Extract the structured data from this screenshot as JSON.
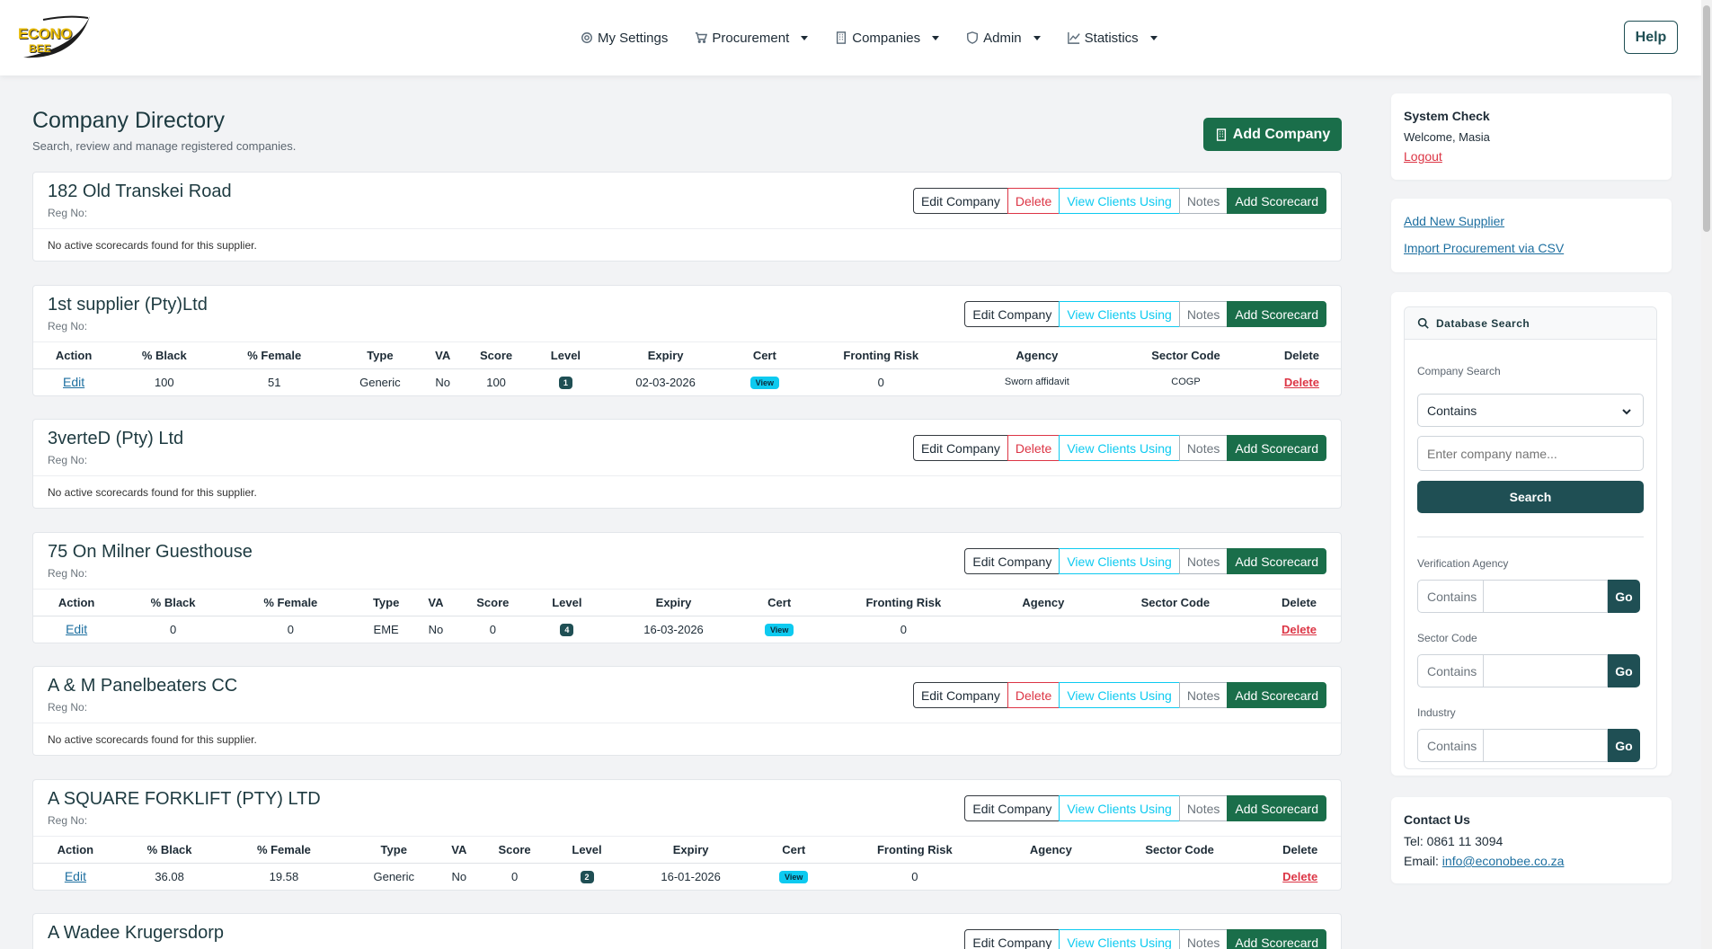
{
  "nav": {
    "logo_line1": "ECONO",
    "logo_line2": "BEE",
    "items": [
      {
        "label": "My Settings",
        "icon": "gear-icon"
      },
      {
        "label": "Procurement",
        "icon": "cart-icon"
      },
      {
        "label": "Companies",
        "icon": "building-icon"
      },
      {
        "label": "Admin",
        "icon": "shield-icon"
      },
      {
        "label": "Statistics",
        "icon": "chart-line-icon"
      }
    ],
    "help": "Help"
  },
  "page": {
    "title": "Company Directory",
    "subtitle": "Search, review and manage registered companies.",
    "add_company": "Add Company"
  },
  "labels": {
    "edit_company": "Edit Company",
    "delete": "Delete",
    "view_clients": "View Clients Using",
    "notes": "Notes",
    "add_scorecard": "Add Scorecard",
    "reg_no": "Reg No:",
    "no_scorecards": "No active scorecards found for this supplier."
  },
  "table_headers": [
    "Action",
    "% Black",
    "% Female",
    "Type",
    "VA",
    "Score",
    "Level",
    "Expiry",
    "Cert",
    "Fronting Risk",
    "Agency",
    "Sector Code",
    "Delete"
  ],
  "row_labels": {
    "edit": "Edit",
    "view": "View",
    "delete": "Delete"
  },
  "companies": [
    {
      "name": "182 Old Transkei Road"
    },
    {
      "name": "1st supplier (Pty)Ltd",
      "row": {
        "black": "100",
        "female": "51",
        "type": "Generic",
        "va": "No",
        "score": "100",
        "level": "1",
        "expiry": "02-03-2026",
        "fronting": "0",
        "agency": "Sworn affidavit",
        "sector": "COGP"
      }
    },
    {
      "name": "3verteD (Pty) Ltd"
    },
    {
      "name": "75 On Milner Guesthouse",
      "row": {
        "black": "0",
        "female": "0",
        "type": "EME",
        "va": "No",
        "score": "0",
        "level": "4",
        "expiry": "16-03-2026",
        "fronting": "0",
        "agency": "",
        "sector": ""
      }
    },
    {
      "name": "A & M Panelbeaters CC"
    },
    {
      "name": "A SQUARE FORKLIFT (PTY) LTD",
      "row": {
        "black": "36.08",
        "female": "19.58",
        "type": "Generic",
        "va": "No",
        "score": "0",
        "level": "2",
        "expiry": "16-01-2026",
        "fronting": "0",
        "agency": "",
        "sector": ""
      }
    },
    {
      "name": "A Wadee Krugersdorp"
    }
  ],
  "sidebar": {
    "system_check": "System Check",
    "welcome": "Welcome, Masia",
    "logout": "Logout",
    "add_supplier": "Add New Supplier",
    "import_csv": "Import Procurement via CSV",
    "db_search": "Database Search",
    "company_search": "Company Search",
    "company_mode": "Contains",
    "company_placeholder": "Enter company name...",
    "search": "Search",
    "verification_agency": "Verification Agency",
    "sector_code": "Sector Code",
    "industry": "Industry",
    "contains": "Contains",
    "go": "Go",
    "contact_title": "Contact Us",
    "tel": "Tel: 0861 11 3094",
    "email_label": "Email: ",
    "email": "info@econobee.co.za"
  }
}
